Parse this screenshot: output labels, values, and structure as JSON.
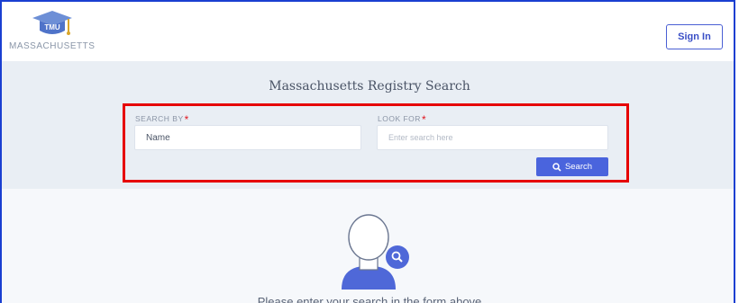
{
  "header": {
    "logo_text": "TMU",
    "logo_subtitle": "MASSACHUSETTS",
    "signin_label": "Sign In"
  },
  "search": {
    "title": "Massachusetts Registry Search",
    "search_by_label": "SEARCH BY",
    "search_by_value": "Name",
    "look_for_label": "LOOK FOR",
    "look_for_placeholder": "Enter search here",
    "required_mark": "*",
    "button_label": "Search"
  },
  "results": {
    "hint": "Please enter your search in the form above"
  },
  "colors": {
    "accent": "#4a64dd",
    "highlight": "#e60000",
    "required": "#e0161f",
    "frame": "#1a3fd1"
  }
}
